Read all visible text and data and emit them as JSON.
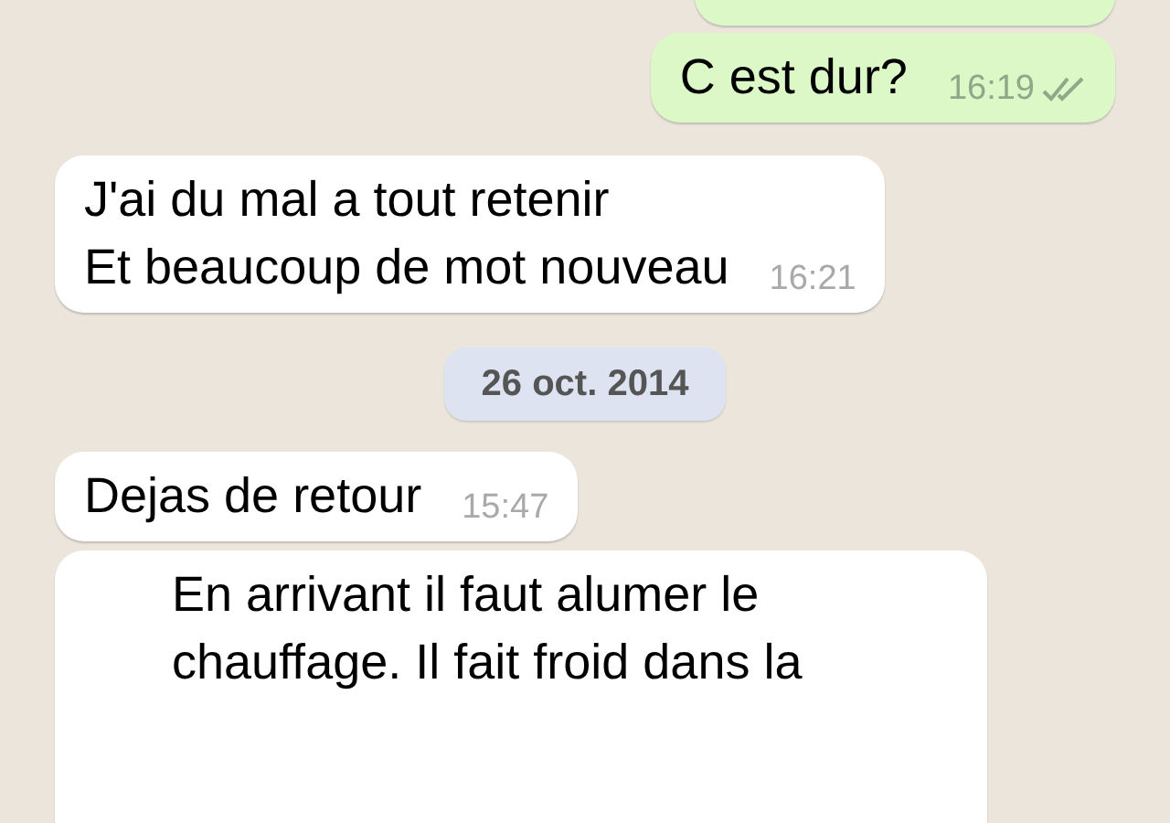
{
  "messages": [
    {
      "kind": "outgoing",
      "cut": true
    },
    {
      "kind": "outgoing",
      "text": "C est dur?",
      "time": "16:19",
      "delivered": true
    },
    {
      "kind": "incoming",
      "text": "J'ai du mal a tout retenir\nEt beaucoup de mot nouveau",
      "time": "16:21"
    },
    {
      "kind": "date",
      "text": "26 oct. 2014"
    },
    {
      "kind": "incoming",
      "text": "Dejas de retour",
      "time": "15:47"
    },
    {
      "kind": "incoming",
      "text": "En arrivant il faut alumer le chauffage. Il fait froid dans la",
      "cut": true
    }
  ]
}
